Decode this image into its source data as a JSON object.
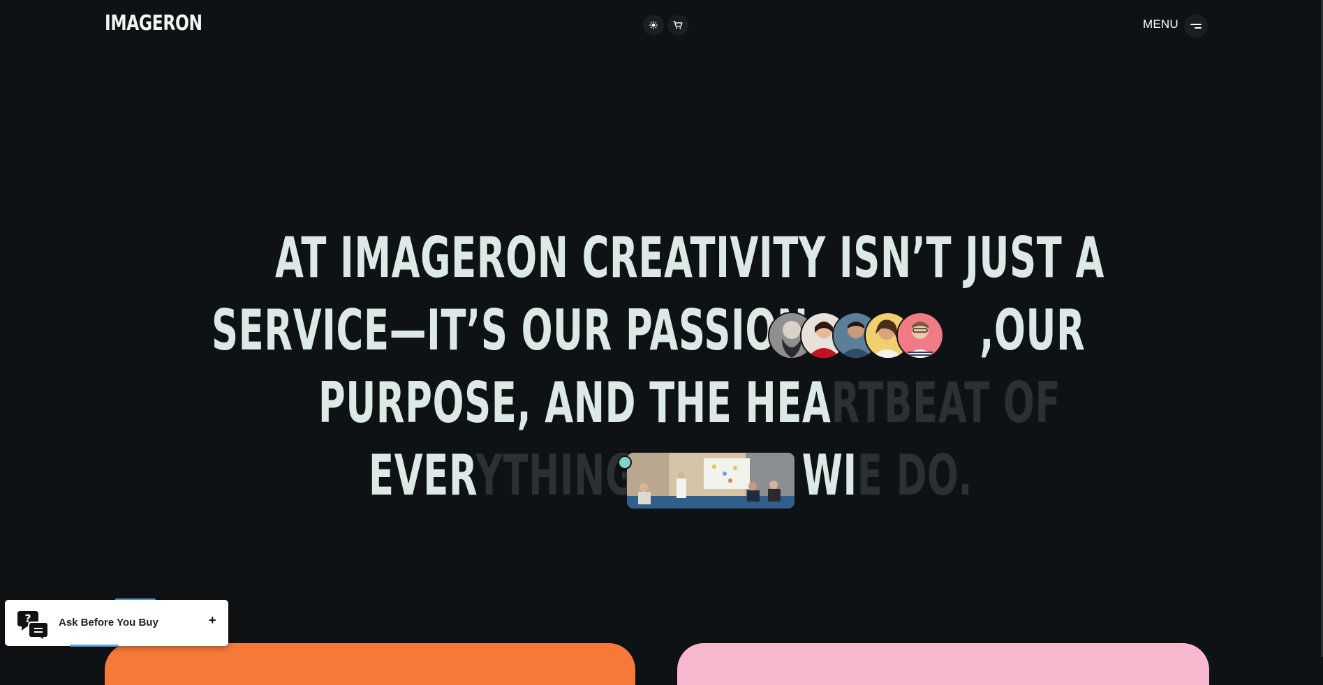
{
  "header": {
    "logo": "IMAGERON",
    "theme_icon": "sun-icon",
    "cart_icon": "cart-icon",
    "menu_label": "MENU",
    "menu_icon": "hamburger-icon"
  },
  "hero": {
    "line1": "AT IMAGERON CREATIVITY ISN’T JUST A",
    "line2_a": "SERVICE—IT’S OUR PASSION",
    "line2_b": ",OUR",
    "line3_bright": "PURPOSE, AND THE HEA",
    "line3_dim": "RTBEAT OF",
    "line4_bright_a": "EVER",
    "line4_dim_a": "YTHING",
    "line4_bright_b": "WI",
    "line4_dim_b": "E DO."
  },
  "chat_widget": {
    "label": "Ask Before You Buy",
    "expand": "+",
    "icon": "chat-question-icon"
  },
  "colors": {
    "background": "#0f1214",
    "hero_text": "#dde9e7",
    "hero_dim": "#2b3033",
    "orange_card": "#f57a3a",
    "pink_card": "#f7b7cf"
  }
}
